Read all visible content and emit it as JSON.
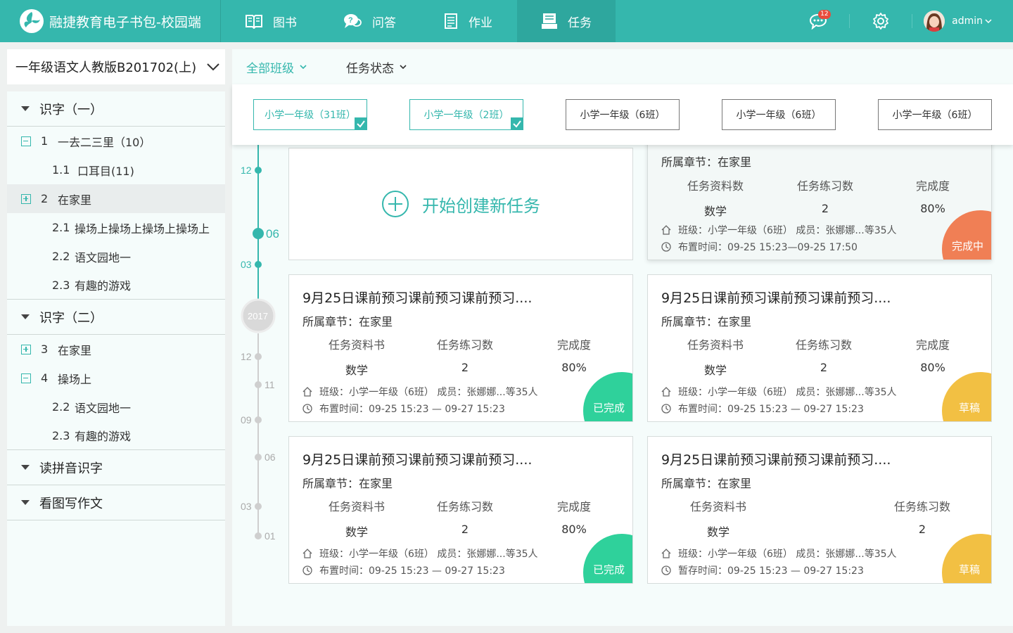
{
  "app": {
    "title": "融捷教育电子书包-校园端"
  },
  "nav": [
    {
      "label": "图书",
      "icon": "book-icon"
    },
    {
      "label": "问答",
      "icon": "qa-icon"
    },
    {
      "label": "作业",
      "icon": "homework-icon"
    },
    {
      "label": "任务",
      "icon": "task-icon",
      "active": true
    }
  ],
  "header": {
    "message_badge": "12",
    "username": "admin"
  },
  "sidebar": {
    "book": "一年级语文人教版B201702(上)",
    "units": [
      {
        "label": "识字（一）"
      },
      {
        "label": "识字（二）"
      },
      {
        "label": "读拼音识字"
      },
      {
        "label": "看图写作文"
      }
    ],
    "lessons": {
      "l1": {
        "num": "1",
        "label": "一去二三里（10）"
      },
      "l1_1": {
        "num": "1.1",
        "label": "口耳目(11)"
      },
      "l2": {
        "num": "2",
        "label": "在家里"
      },
      "l2_1": {
        "num": "2.1",
        "label": "操场上操场上操场上操场上"
      },
      "l2_2": {
        "num": "2.2",
        "label": "语文园地一"
      },
      "l2_3": {
        "num": "2.3",
        "label": "有趣的游戏"
      },
      "l3": {
        "num": "3",
        "label": "在家里"
      },
      "l4": {
        "num": "4",
        "label": "操场上"
      },
      "l4_2": {
        "num": "2.2",
        "label": "语文园地一"
      },
      "l4_3": {
        "num": "2.3",
        "label": "有趣的游戏"
      }
    }
  },
  "filters": {
    "class_filter": "全部班级",
    "status_filter": "任务状态"
  },
  "classes": [
    {
      "label": "小学一年级（31班）",
      "selected": true
    },
    {
      "label": "小学一年级（2班）",
      "selected": true
    },
    {
      "label": "小学一年级（6班）",
      "selected": false
    },
    {
      "label": "小学一年级（6班）",
      "selected": false
    },
    {
      "label": "小学一年级（6班）",
      "selected": false
    }
  ],
  "timeline": {
    "m12": "12",
    "d06": "06",
    "m03": "03",
    "year": "2017",
    "g12": "12",
    "g11": "11",
    "g09": "09",
    "g06": "06",
    "g03": "03",
    "g01": "01"
  },
  "create_label": "开始创建新任务",
  "cards": {
    "c0": {
      "chapter": "所属章节：在家里",
      "h1": "任务资料数",
      "h2": "任务练习数",
      "h3": "完成度",
      "v1": "数学",
      "v2": "2",
      "v3": "80%",
      "members": "班级：小学一年级（6班）   成员：张娜娜...等35人",
      "time": "布置时间：09-25  15:23—09-25  17:50",
      "status": "完成中",
      "status_color": "#f07f55"
    },
    "c1": {
      "title": "9月25日课前预习课前预习课前预习....",
      "chapter": "所属章节：在家里",
      "h1": "任务资料书",
      "h2": "任务练习数",
      "h3": "完成度",
      "v1": "数学",
      "v2": "2",
      "v3": "80%",
      "members": "班级：小学一年级（6班）   成员：张娜娜...等35人",
      "time": "布置时间：09-25  15:23 — 09-27 15:23",
      "status": "已完成",
      "status_color": "#2fd19b"
    },
    "c2": {
      "title": "9月25日课前预习课前预习课前预习....",
      "chapter": "所属章节：在家里",
      "h1": "任务资料书",
      "h2": "任务练习数",
      "h3": "完成度",
      "v1": "数学",
      "v2": "2",
      "v3": "80%",
      "members": "班级：小学一年级（6班）   成员：张娜娜...等35人",
      "time": "布置时间：09-25  15:23 — 09-27 15:23",
      "status": "草稿",
      "status_color": "#f2c043"
    },
    "c3": {
      "title": "9月25日课前预习课前预习课前预习....",
      "chapter": "所属章节：在家里",
      "h1": "任务资料书",
      "h2": "任务练习数",
      "h3": "完成度",
      "v1": "数学",
      "v2": "2",
      "v3": "80%",
      "members": "班级：小学一年级（6班）   成员：张娜娜...等35人",
      "time": "布置时间：09-25  15:23 — 09-27 15:23",
      "status": "已完成",
      "status_color": "#2fd19b"
    },
    "c4": {
      "title": "9月25日课前预习课前预习课前预习....",
      "chapter": "所属章节：在家里",
      "h1": "任务资料书",
      "h2": "任务练习数",
      "v1": "数学",
      "v2": "2",
      "members": "班级：小学一年级（6班）   成员：张娜娜...等35人",
      "time": "暂存时间：09-25  15:23 — 09-27 15:23",
      "status": "草稿",
      "status_color": "#f2c043"
    }
  }
}
